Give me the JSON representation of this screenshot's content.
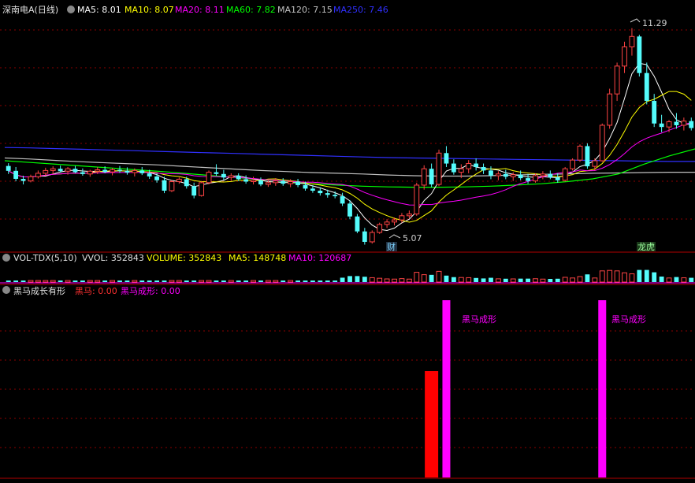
{
  "header": {
    "title": "深南电A(日线)",
    "ma5": "MA5: 8.01",
    "ma10": "MA10: 8.07",
    "ma20": "MA20: 8.11",
    "ma60": "MA60: 7.82",
    "ma120": "MA120: 7.15",
    "ma250": "MA250: 7.46"
  },
  "vol_header": {
    "title": "VOL-TDX(5,10)",
    "vvol": "VVOL: 352843",
    "volume": "VOLUME: 352843",
    "ma5": "MA5: 148748",
    "ma10": "MA10: 120687"
  },
  "ind_header": {
    "title": "黑马成长有形",
    "heima": "黑马: 0.00",
    "chengxing": "黑马成形: 0.00"
  },
  "annotations": {
    "high": "11.29",
    "low": "5.07",
    "cai": "财",
    "longhu": "龙虎",
    "signal1": "黑马成形",
    "signal2": "黑马成形"
  },
  "colors": {
    "up": "#ff4444",
    "down": "#54fcfc",
    "ma5": "#ffffff",
    "ma10": "#ffff00",
    "ma20": "#ff00ff",
    "ma60": "#00ff00",
    "ma120": "#c0c0c0",
    "ma250": "#3030ff",
    "grid": "#8b0000",
    "heima": "#ff0000",
    "chengxing": "#ff00ff"
  },
  "chart_data": {
    "type": "candlestick",
    "high_label": 11.29,
    "low_label": 5.07,
    "ylim": [
      4.9,
      11.6
    ],
    "candles": [
      [
        7.33,
        7.41,
        7.1,
        7.19
      ],
      [
        7.19,
        7.3,
        6.89,
        6.96
      ],
      [
        6.96,
        7.05,
        6.8,
        6.9
      ],
      [
        6.9,
        7.08,
        6.86,
        7.02
      ],
      [
        7.02,
        7.2,
        6.97,
        7.12
      ],
      [
        7.12,
        7.28,
        7.05,
        7.2
      ],
      [
        7.2,
        7.32,
        7.1,
        7.25
      ],
      [
        7.25,
        7.34,
        7.15,
        7.18
      ],
      [
        7.18,
        7.3,
        7.08,
        7.25
      ],
      [
        7.25,
        7.33,
        7.12,
        7.15
      ],
      [
        7.15,
        7.26,
        7.05,
        7.1
      ],
      [
        7.1,
        7.22,
        7.02,
        7.18
      ],
      [
        7.18,
        7.3,
        7.1,
        7.22
      ],
      [
        7.22,
        7.32,
        7.12,
        7.16
      ],
      [
        7.16,
        7.27,
        7.06,
        7.22
      ],
      [
        7.22,
        7.33,
        7.13,
        7.19
      ],
      [
        7.19,
        7.29,
        7.08,
        7.14
      ],
      [
        7.14,
        7.26,
        7.03,
        7.2
      ],
      [
        7.2,
        7.3,
        7.07,
        7.12
      ],
      [
        7.12,
        7.22,
        6.96,
        7.03
      ],
      [
        7.03,
        7.12,
        6.85,
        6.92
      ],
      [
        6.92,
        7.02,
        6.55,
        6.62
      ],
      [
        6.62,
        6.92,
        6.58,
        6.88
      ],
      [
        6.88,
        7.0,
        6.82,
        6.95
      ],
      [
        6.95,
        7.02,
        6.68,
        6.75
      ],
      [
        6.75,
        6.85,
        6.4,
        6.48
      ],
      [
        6.48,
        6.9,
        6.45,
        6.85
      ],
      [
        6.85,
        7.2,
        6.8,
        7.15
      ],
      [
        7.15,
        7.38,
        7.05,
        7.1
      ],
      [
        7.1,
        7.22,
        6.92,
        7.0
      ],
      [
        7.0,
        7.12,
        6.9,
        7.05
      ],
      [
        7.05,
        7.12,
        6.9,
        6.95
      ],
      [
        6.95,
        7.06,
        6.82,
        6.88
      ],
      [
        6.88,
        7.02,
        6.8,
        6.92
      ],
      [
        6.92,
        7.0,
        6.75,
        6.8
      ],
      [
        6.8,
        6.92,
        6.73,
        6.85
      ],
      [
        6.85,
        6.98,
        6.76,
        6.9
      ],
      [
        6.9,
        6.98,
        6.76,
        6.82
      ],
      [
        6.82,
        6.95,
        6.72,
        6.88
      ],
      [
        6.88,
        6.96,
        6.72,
        6.78
      ],
      [
        6.78,
        6.88,
        6.62,
        6.68
      ],
      [
        6.68,
        6.78,
        6.56,
        6.62
      ],
      [
        6.62,
        6.72,
        6.48,
        6.55
      ],
      [
        6.55,
        6.65,
        6.42,
        6.5
      ],
      [
        6.5,
        6.6,
        6.4,
        6.46
      ],
      [
        6.46,
        6.56,
        6.18,
        6.25
      ],
      [
        6.25,
        6.35,
        5.8,
        5.88
      ],
      [
        5.88,
        5.95,
        5.4,
        5.45
      ],
      [
        5.45,
        5.55,
        5.07,
        5.15
      ],
      [
        5.15,
        5.48,
        5.1,
        5.42
      ],
      [
        5.42,
        5.7,
        5.38,
        5.65
      ],
      [
        5.65,
        5.8,
        5.55,
        5.72
      ],
      [
        5.72,
        5.85,
        5.62,
        5.78
      ],
      [
        5.78,
        5.98,
        5.7,
        5.9
      ],
      [
        5.9,
        6.05,
        5.82,
        5.95
      ],
      [
        5.95,
        6.85,
        5.9,
        6.78
      ],
      [
        6.78,
        7.35,
        6.65,
        7.25
      ],
      [
        7.25,
        7.4,
        6.72,
        6.8
      ],
      [
        6.8,
        7.8,
        6.75,
        7.7
      ],
      [
        7.7,
        7.9,
        7.3,
        7.4
      ],
      [
        7.4,
        7.52,
        7.08,
        7.15
      ],
      [
        7.15,
        7.38,
        6.98,
        7.25
      ],
      [
        7.25,
        7.5,
        7.12,
        7.4
      ],
      [
        7.4,
        7.55,
        7.2,
        7.3
      ],
      [
        7.3,
        7.4,
        7.1,
        7.2
      ],
      [
        7.2,
        7.32,
        6.95,
        7.05
      ],
      [
        7.05,
        7.18,
        6.92,
        7.1
      ],
      [
        7.1,
        7.22,
        6.95,
        7.02
      ],
      [
        7.02,
        7.15,
        6.9,
        7.08
      ],
      [
        7.08,
        7.2,
        6.92,
        6.98
      ],
      [
        6.98,
        7.1,
        6.82,
        6.9
      ],
      [
        6.9,
        7.12,
        6.85,
        7.05
      ],
      [
        7.05,
        7.18,
        6.95,
        7.1
      ],
      [
        7.1,
        7.2,
        6.95,
        7.0
      ],
      [
        7.0,
        7.12,
        6.85,
        6.92
      ],
      [
        6.92,
        7.3,
        6.88,
        7.25
      ],
      [
        7.25,
        7.55,
        7.2,
        7.5
      ],
      [
        7.5,
        7.95,
        7.45,
        7.9
      ],
      [
        7.9,
        7.98,
        7.25,
        7.32
      ],
      [
        7.32,
        7.55,
        7.2,
        7.48
      ],
      [
        7.48,
        8.55,
        7.45,
        8.5
      ],
      [
        8.5,
        9.55,
        8.4,
        9.4
      ],
      [
        9.4,
        10.3,
        9.2,
        10.2
      ],
      [
        10.2,
        10.9,
        10.0,
        10.75
      ],
      [
        10.75,
        11.29,
        10.5,
        11.05
      ],
      [
        11.05,
        11.1,
        9.9,
        10.0
      ],
      [
        10.0,
        10.3,
        9.1,
        9.2
      ],
      [
        9.2,
        9.4,
        8.45,
        8.55
      ],
      [
        8.55,
        8.8,
        8.3,
        8.45
      ],
      [
        8.45,
        8.65,
        8.3,
        8.6
      ],
      [
        8.6,
        8.85,
        8.4,
        8.5
      ],
      [
        8.5,
        8.72,
        8.35,
        8.62
      ],
      [
        8.62,
        8.72,
        8.35,
        8.42
      ]
    ],
    "ma250": [
      7.86,
      7.85,
      7.83,
      7.81,
      7.79,
      7.77,
      7.75,
      7.73,
      7.71,
      7.69,
      7.67,
      7.65,
      7.63,
      7.61,
      7.59,
      7.57,
      7.56,
      7.55,
      7.54,
      7.53,
      7.52,
      7.51,
      7.5,
      7.49,
      7.48,
      7.47,
      7.46,
      7.46
    ],
    "ma120": [
      7.56,
      7.53,
      7.49,
      7.45,
      7.42,
      7.39,
      7.36,
      7.32,
      7.28,
      7.24,
      7.2,
      7.17,
      7.14,
      7.12,
      7.1,
      7.07,
      7.05,
      7.04,
      7.04,
      7.05,
      7.07,
      7.09,
      7.1,
      7.12,
      7.13,
      7.14,
      7.15,
      7.15
    ],
    "ma60": [
      7.48,
      7.43,
      7.38,
      7.33,
      7.28,
      7.23,
      7.18,
      7.12,
      7.06,
      7.0,
      6.94,
      6.88,
      6.82,
      6.78,
      6.75,
      6.73,
      6.72,
      6.72,
      6.73,
      6.75,
      6.78,
      6.82,
      6.88,
      6.96,
      7.1,
      7.38,
      7.62,
      7.82
    ],
    "vol": {
      "ma5": 148748,
      "ma10": 120687,
      "vvol": 352843
    },
    "indicator": {
      "heima": 0.0,
      "chengxing": 0.0,
      "signals": [
        {
          "name": "黑马",
          "candle": 57,
          "value": 0.6
        },
        {
          "name": "黑马成形",
          "candle": 59,
          "value": 1.0
        },
        {
          "name": "黑马成形",
          "candle": 80,
          "value": 1.0
        }
      ]
    }
  }
}
